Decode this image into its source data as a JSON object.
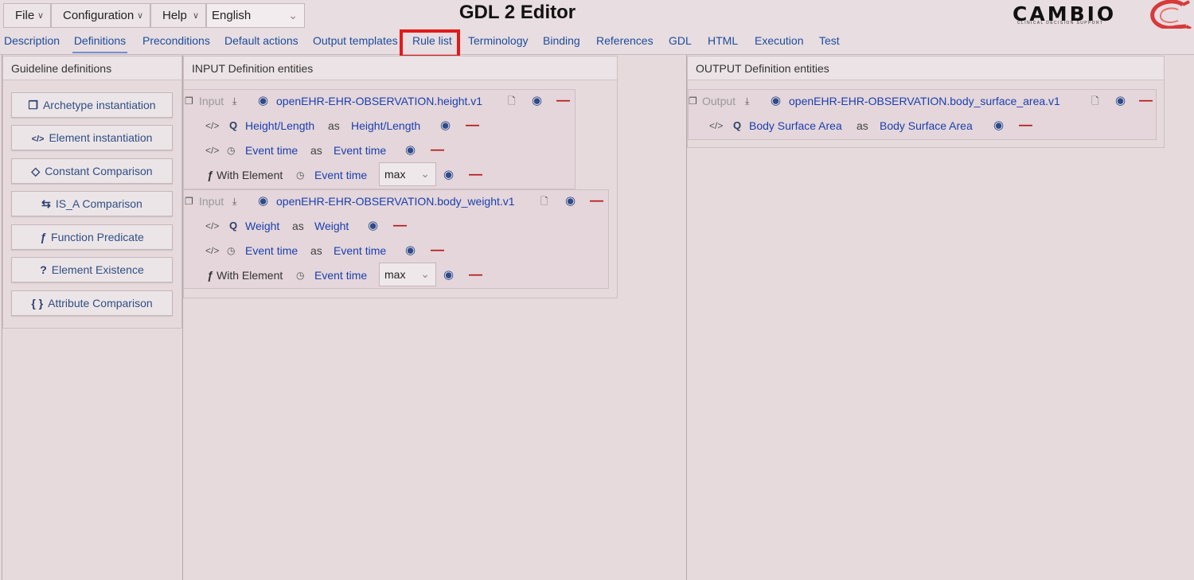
{
  "menu": {
    "file": "File",
    "configuration": "Configuration",
    "help": "Help",
    "language": "English"
  },
  "app_title": "GDL 2 Editor",
  "logo": {
    "name": "CAMBIO",
    "tagline": "CLINICAL DECISION SUPPORT"
  },
  "tabs": [
    "Description",
    "Definitions",
    "Preconditions",
    "Default actions",
    "Output templates",
    "Rule list",
    "Terminology",
    "Binding",
    "References",
    "GDL",
    "HTML",
    "Execution",
    "Test"
  ],
  "active_tab": "Definitions",
  "highlighted_tab": "Rule list",
  "colors": {
    "link": "#1a3fb0",
    "remove": "#b31212",
    "highlight": "#e21a1a",
    "background": "#e6dadd"
  },
  "guideline_definitions": {
    "title": "Guideline definitions",
    "buttons": [
      "Archetype instantiation",
      "Element instantiation",
      "Constant Comparison",
      "IS_A Comparison",
      "Function Predicate",
      "Element Existence",
      "Attribute Comparison"
    ]
  },
  "input_panel": {
    "title": "INPUT Definition entities",
    "entities": [
      {
        "kind": "Input",
        "archetype": "openEHR-EHR-OBSERVATION.height.v1",
        "elements": [
          {
            "name": "Height/Length",
            "as_word": "as",
            "alias": "Height/Length"
          },
          {
            "name": "Event time",
            "as_word": "as",
            "alias": "Event time"
          }
        ],
        "function": {
          "label": "With Element",
          "element": "Event time",
          "value": "max"
        }
      },
      {
        "kind": "Input",
        "archetype": "openEHR-EHR-OBSERVATION.body_weight.v1",
        "elements": [
          {
            "name": "Weight",
            "as_word": "as",
            "alias": "Weight"
          },
          {
            "name": "Event time",
            "as_word": "as",
            "alias": "Event time"
          }
        ],
        "function": {
          "label": "With Element",
          "element": "Event time",
          "value": "max"
        }
      }
    ]
  },
  "output_panel": {
    "title": "OUTPUT Definition entities",
    "entities": [
      {
        "kind": "Output",
        "archetype": "openEHR-EHR-OBSERVATION.body_surface_area.v1",
        "elements": [
          {
            "name": "Body Surface Area",
            "as_word": "as",
            "alias": "Body Surface Area"
          }
        ]
      }
    ]
  }
}
